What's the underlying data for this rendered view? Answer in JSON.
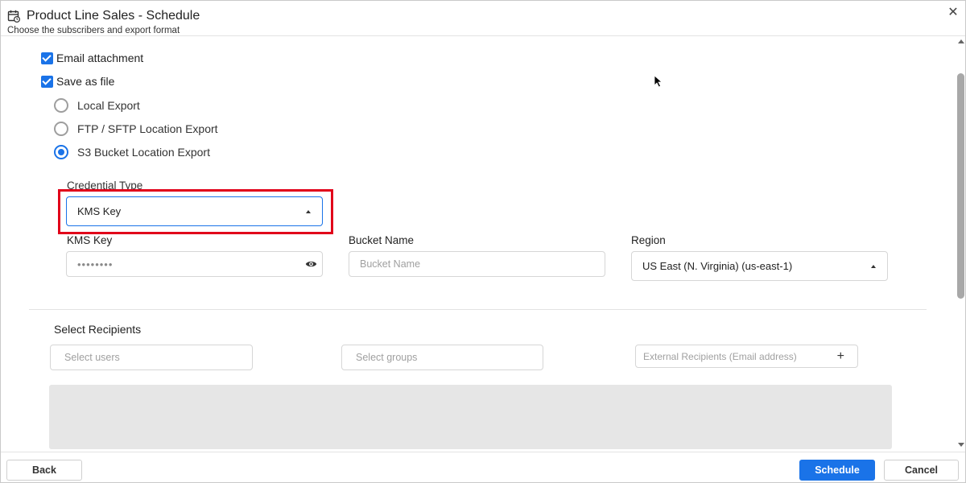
{
  "dialog": {
    "title": "Product Line Sales - Schedule",
    "subtitle": "Choose the subscribers and export format"
  },
  "delivery": {
    "email_attachment": {
      "label": "Email attachment",
      "checked": true
    },
    "save_as_file": {
      "label": "Save as file",
      "checked": true
    }
  },
  "export_options": [
    {
      "label": "Local Export",
      "selected": false
    },
    {
      "label": "FTP / SFTP Location Export",
      "selected": false
    },
    {
      "label": "S3 Bucket Location Export",
      "selected": true
    }
  ],
  "s3": {
    "credential_type_label": "Credential Type",
    "credential_type_value": "KMS Key",
    "kms_key_label": "KMS Key",
    "kms_key_value": "••••••••",
    "bucket_name_label": "Bucket Name",
    "bucket_name_placeholder": "Bucket Name",
    "region_label": "Region",
    "region_value": "US East (N. Virginia) (us-east-1)"
  },
  "recipients": {
    "title": "Select Recipients",
    "users_placeholder": "Select users",
    "groups_placeholder": "Select groups",
    "external_placeholder": "External Recipients (Email address)"
  },
  "footer": {
    "back_label": "Back",
    "schedule_label": "Schedule",
    "cancel_label": "Cancel"
  },
  "colors": {
    "accent": "#1a73e8",
    "highlight": "#e1001a"
  },
  "icons": {
    "calendar": "calendar-icon",
    "close": "close-icon",
    "eye": "eye-icon",
    "plus": "plus-icon"
  }
}
